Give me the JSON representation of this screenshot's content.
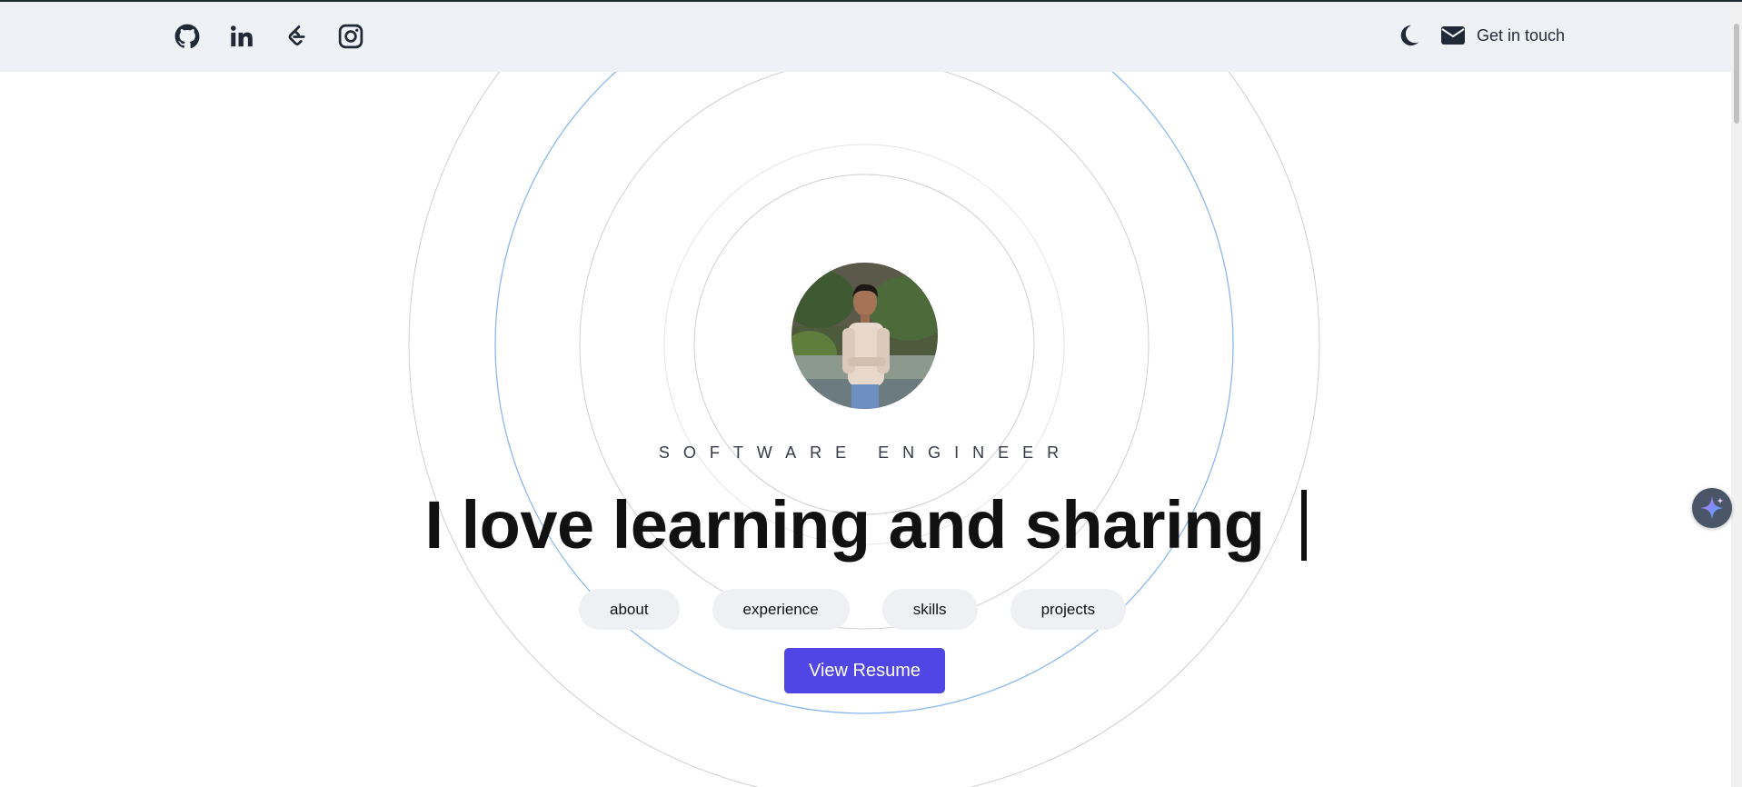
{
  "navbar": {
    "social": [
      {
        "name": "github-icon"
      },
      {
        "name": "linkedin-icon"
      },
      {
        "name": "leetcode-icon"
      },
      {
        "name": "instagram-icon"
      }
    ],
    "theme_toggle_icon": "moon-icon",
    "contact_icon": "envelope-icon",
    "contact_label": "Get in touch"
  },
  "hero": {
    "role": "SOFTWARE ENGINEER",
    "headline": "I love learning and sharing",
    "pills": [
      "about",
      "experience",
      "skills",
      "projects"
    ],
    "resume_label": "View Resume"
  },
  "floating_button_icon": "sparkle-icon",
  "colors": {
    "navbar_bg": "#eef1f5",
    "primary": "#4f46e5",
    "ring_gray": "#cfcfcf",
    "ring_blue": "#8ab8f0",
    "pill_bg": "#eef0f3"
  }
}
